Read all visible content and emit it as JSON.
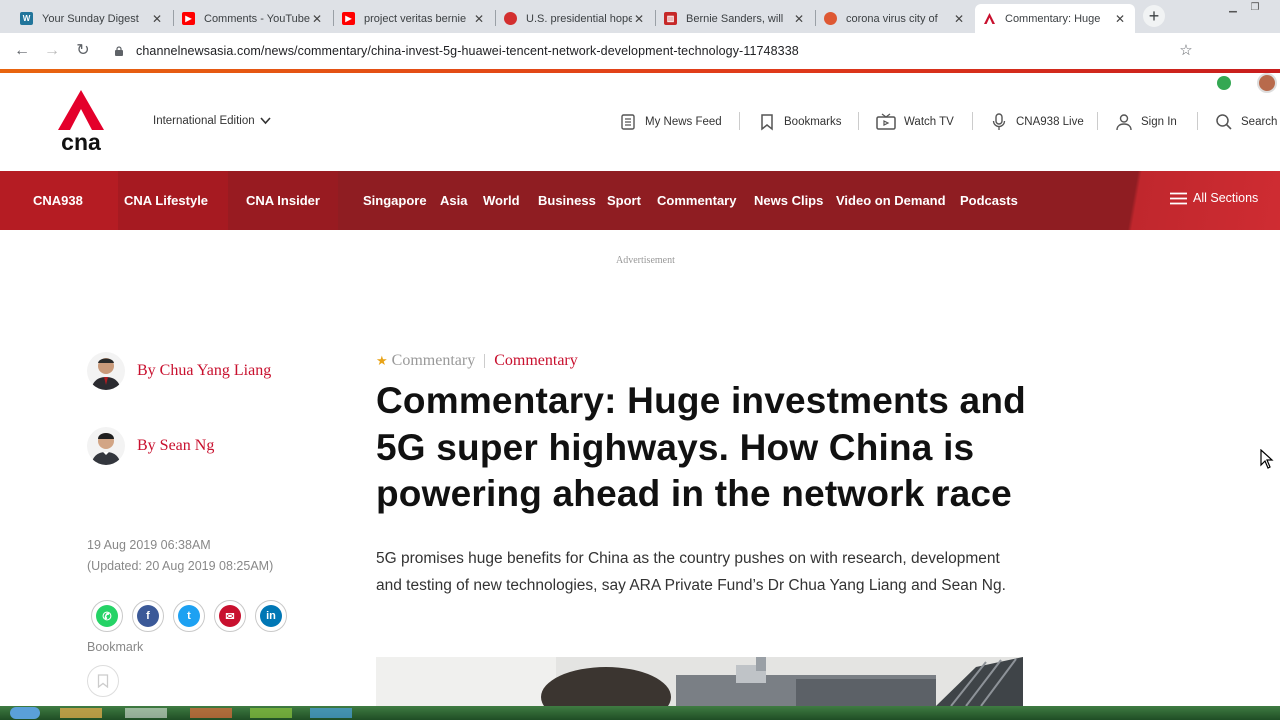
{
  "browser": {
    "tabs": [
      {
        "title": "Your Sunday Digest",
        "favicon": "wordpress-icon",
        "color": "#21759b"
      },
      {
        "title": "Comments - YouTube",
        "favicon": "youtube-icon",
        "color": "#ff0000"
      },
      {
        "title": "project veritas bernie",
        "favicon": "youtube-icon",
        "color": "#ff0000"
      },
      {
        "title": "U.S. presidential hopeful",
        "favicon": "news-icon",
        "color": "#d32f2f"
      },
      {
        "title": "Bernie Sanders, will",
        "favicon": "news-icon",
        "color": "#c62828"
      },
      {
        "title": "corona virus city of",
        "favicon": "duckduckgo-icon",
        "color": "#de5833"
      },
      {
        "title": "Commentary: Huge",
        "favicon": "cna-icon",
        "color": "#c8102e"
      }
    ],
    "url": "channelnewsasia.com/news/commentary/china-invest-5g-huawei-tencent-network-development-technology-11748338"
  },
  "header": {
    "logo_text": "cna",
    "edition": "International Edition",
    "utilities": [
      {
        "label": "My News Feed",
        "icon": "news-feed-icon"
      },
      {
        "label": "Bookmarks",
        "icon": "bookmark-icon"
      },
      {
        "label": "Watch TV",
        "icon": "tv-icon"
      },
      {
        "label": "CNA938 Live",
        "icon": "microphone-icon"
      },
      {
        "label": "Sign In",
        "icon": "user-icon"
      },
      {
        "label": "Search",
        "icon": "search-icon"
      }
    ]
  },
  "nav": {
    "items": [
      "CNA938",
      "CNA Lifestyle",
      "CNA Insider",
      "Singapore",
      "Asia",
      "World",
      "Business",
      "Sport",
      "Commentary",
      "News Clips",
      "Video on Demand",
      "Podcasts"
    ],
    "all_sections": "All Sections"
  },
  "advertisement": "Advertisement",
  "article": {
    "authors": [
      "By Chua Yang Liang",
      "By Sean Ng"
    ],
    "published": "19 Aug 2019 06:38AM",
    "updated": "(Updated: 20 Aug 2019 08:25AM)",
    "share": [
      {
        "name": "whatsapp",
        "color": "#25d366",
        "glyph": "✆"
      },
      {
        "name": "facebook",
        "color": "#3b5998",
        "glyph": "f"
      },
      {
        "name": "twitter",
        "color": "#1da1f2",
        "glyph": "t"
      },
      {
        "name": "email",
        "color": "#c8102e",
        "glyph": "✉"
      },
      {
        "name": "linkedin",
        "color": "#0077b5",
        "glyph": "in"
      }
    ],
    "bookmark_label": "Bookmark",
    "crumb_primary": "Commentary",
    "crumb_secondary": "Commentary",
    "headline": "Commentary: Huge investments and 5G super highways. How China is powering ahead in the network race",
    "summary": "5G promises huge benefits for China as the country pushes on with research, development and testing of new technologies, say ARA Private Fund’s Dr Chua Yang Liang and Sean Ng."
  },
  "colors": {
    "brand_red": "#c8102e",
    "nav_red": "#8f1d22"
  }
}
